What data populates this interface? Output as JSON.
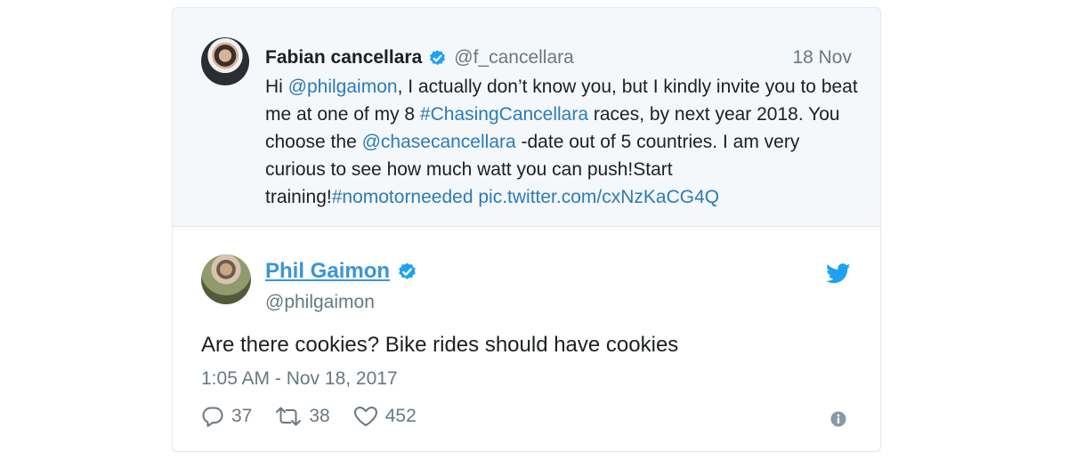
{
  "quoted_tweet": {
    "author_name": "Fabian cancellara",
    "author_handle": "@f_cancellara",
    "date": "18 Nov",
    "text_parts": [
      {
        "text": "Hi ",
        "link": false
      },
      {
        "text": "@philgaimon",
        "link": true
      },
      {
        "text": ", I actually don’t know you, but I kindly invite you to beat me at one of my 8 ",
        "link": false
      },
      {
        "text": "#ChasingCancellara",
        "link": true
      },
      {
        "text": " races, by next year 2018. You choose the ",
        "link": false
      },
      {
        "text": "@chasecancellara",
        "link": true
      },
      {
        "text": " -date out of 5 countries. I am very curious to see how much watt you can push!Start training!",
        "link": false
      },
      {
        "text": "#nomotorneeded",
        "link": true
      },
      {
        "text": " ",
        "link": false
      },
      {
        "text": "pic.twitter.com/cxNzKaCG4Q",
        "link": true
      }
    ]
  },
  "tweet": {
    "author_name": "Phil Gaimon",
    "author_handle": "@philgaimon",
    "text": "Are there cookies? Bike rides should have cookies",
    "timestamp": "1:05 AM - Nov 18, 2017",
    "replies": "37",
    "retweets": "38",
    "likes": "452"
  },
  "colors": {
    "link": "#2b7bb9",
    "verified": "#1da1f2",
    "muted": "#697882",
    "quoted_bg": "#f5f8fa"
  },
  "icons": {
    "verified": "verified-badge-icon",
    "twitter": "twitter-bird-icon",
    "reply": "reply-icon",
    "retweet": "retweet-icon",
    "like": "heart-icon",
    "info": "info-icon"
  }
}
